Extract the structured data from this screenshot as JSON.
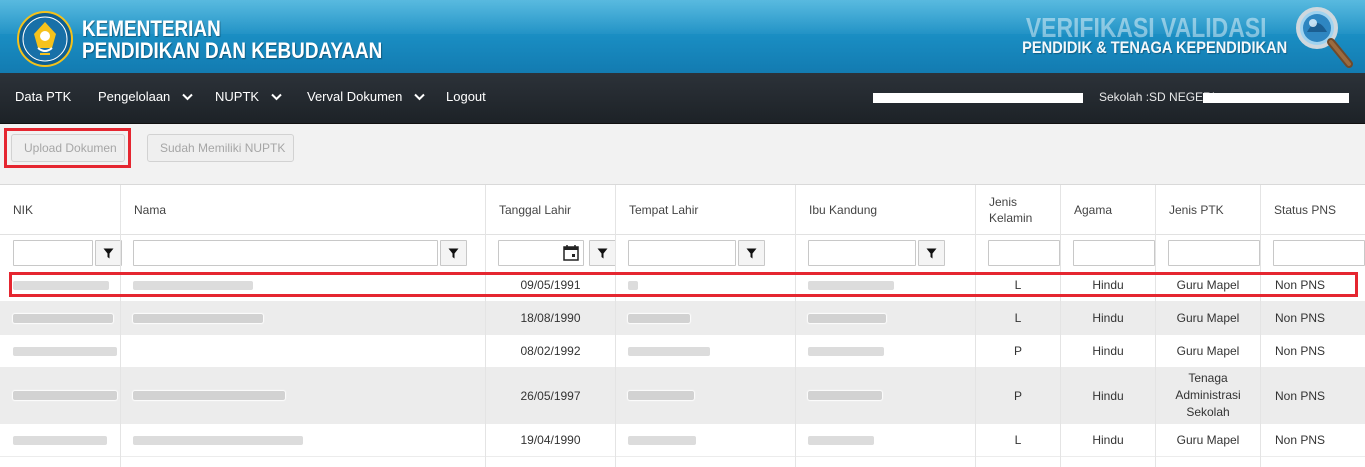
{
  "header": {
    "ministry_line1": "KEMENTERIAN",
    "ministry_line2": "PENDIDIKAN DAN KEBUDAYAAN",
    "brand_line1": "VERIFIKASI VALIDASI",
    "brand_line2": "PENDIDIK & TENAGA KEPENDIDIKAN",
    "logo_icon": "tut-wuri-handayani-logo",
    "magnifier_icon": "magnifier-logo-icon"
  },
  "nav": {
    "items": [
      {
        "label": "Data PTK",
        "has_dropdown": false
      },
      {
        "label": "Pengelolaan",
        "has_dropdown": true
      },
      {
        "label": "NUPTK",
        "has_dropdown": true
      },
      {
        "label": "Verval Dokumen",
        "has_dropdown": true
      },
      {
        "label": "Logout",
        "has_dropdown": false
      }
    ],
    "user_text": "Sekolah :SD NEGERI"
  },
  "toolbar": {
    "upload_label": "Upload Dokumen",
    "nuptk_label": "Sudah Memiliki NUPTK"
  },
  "table": {
    "columns": [
      "NIK",
      "Nama",
      "Tanggal Lahir",
      "Tempat Lahir",
      "Ibu Kandung",
      "Jenis Kelamin",
      "Agama",
      "Jenis PTK",
      "Status PNS"
    ],
    "rows": [
      {
        "nik": "",
        "nama": "",
        "tanggal_lahir": "09/05/1991",
        "tempat_lahir": "",
        "ibu_kandung": "",
        "jenis_kelamin": "L",
        "agama": "Hindu",
        "jenis_ptk": "Guru Mapel",
        "status_pns": "Non PNS"
      },
      {
        "nik": "",
        "nama": "",
        "tanggal_lahir": "18/08/1990",
        "tempat_lahir": "",
        "ibu_kandung": "",
        "jenis_kelamin": "L",
        "agama": "Hindu",
        "jenis_ptk": "Guru Mapel",
        "status_pns": "Non PNS"
      },
      {
        "nik": "",
        "nama": "",
        "tanggal_lahir": "08/02/1992",
        "tempat_lahir": "",
        "ibu_kandung": "",
        "jenis_kelamin": "P",
        "agama": "Hindu",
        "jenis_ptk": "Guru Mapel",
        "status_pns": "Non PNS"
      },
      {
        "nik": "",
        "nama": "",
        "tanggal_lahir": "26/05/1997",
        "tempat_lahir": "",
        "ibu_kandung": "",
        "jenis_kelamin": "P",
        "agama": "Hindu",
        "jenis_ptk": "Tenaga Administrasi Sekolah",
        "status_pns": "Non PNS"
      },
      {
        "nik": "",
        "nama": "",
        "tanggal_lahir": "19/04/1990",
        "tempat_lahir": "",
        "ibu_kandung": "",
        "jenis_kelamin": "L",
        "agama": "Hindu",
        "jenis_ptk": "Guru Mapel",
        "status_pns": "Non PNS"
      }
    ]
  },
  "icons": {
    "filter": "filter-icon",
    "calendar": "calendar-icon",
    "caret": "chevron-down-icon"
  },
  "colors": {
    "banner": "#1a8fc4",
    "navbar": "#23292f",
    "highlight": "#e52630"
  }
}
